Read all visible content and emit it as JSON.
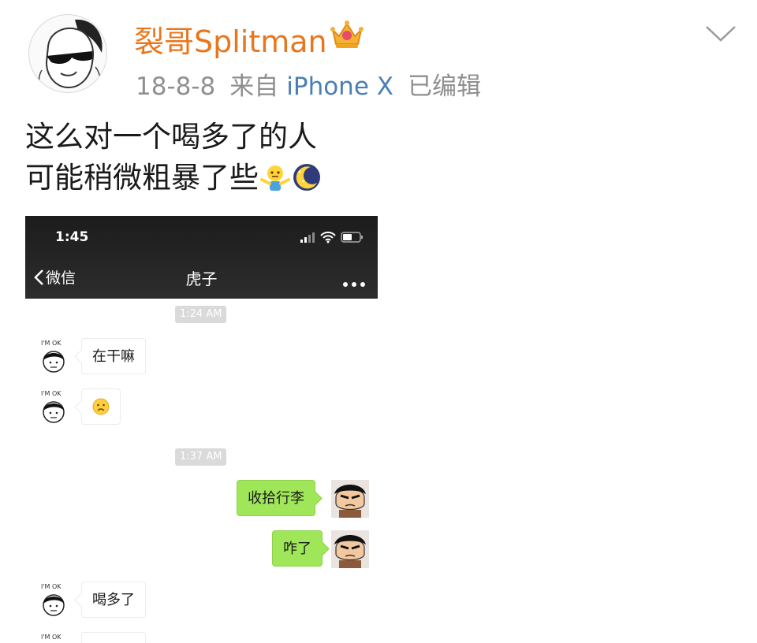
{
  "post": {
    "username": "裂哥Splitman",
    "date": "18-8-8",
    "source_prefix": "来自",
    "device": "iPhone X",
    "edited": "已编辑",
    "text_lines": [
      "这么对一个喝多了的人",
      "可能稍微粗暴了些"
    ],
    "icons": [
      "user-avatar",
      "crown-icon",
      "chevron-down-icon",
      "shrug-emoji",
      "moon-emoji"
    ]
  },
  "screenshot": {
    "status_time": "1:45",
    "back_label": "微信",
    "chat_title": "虎子",
    "timestamps": [
      "1:24 AM",
      "1:37 AM"
    ],
    "avatar_caption": "I'M OK",
    "messages": [
      {
        "from": "them",
        "text": "在干嘛"
      },
      {
        "from": "them",
        "text": "",
        "emoji": "frowning-face-emoji"
      },
      {
        "from": "me",
        "text": "收拾行李"
      },
      {
        "from": "me",
        "text": "咋了"
      },
      {
        "from": "them",
        "text": "喝多了"
      }
    ],
    "colors": {
      "outgoing_bubble": "#9fe658",
      "nav_bar": "#262626",
      "username": "#e8761c",
      "device_link": "#4a7fb5"
    }
  }
}
